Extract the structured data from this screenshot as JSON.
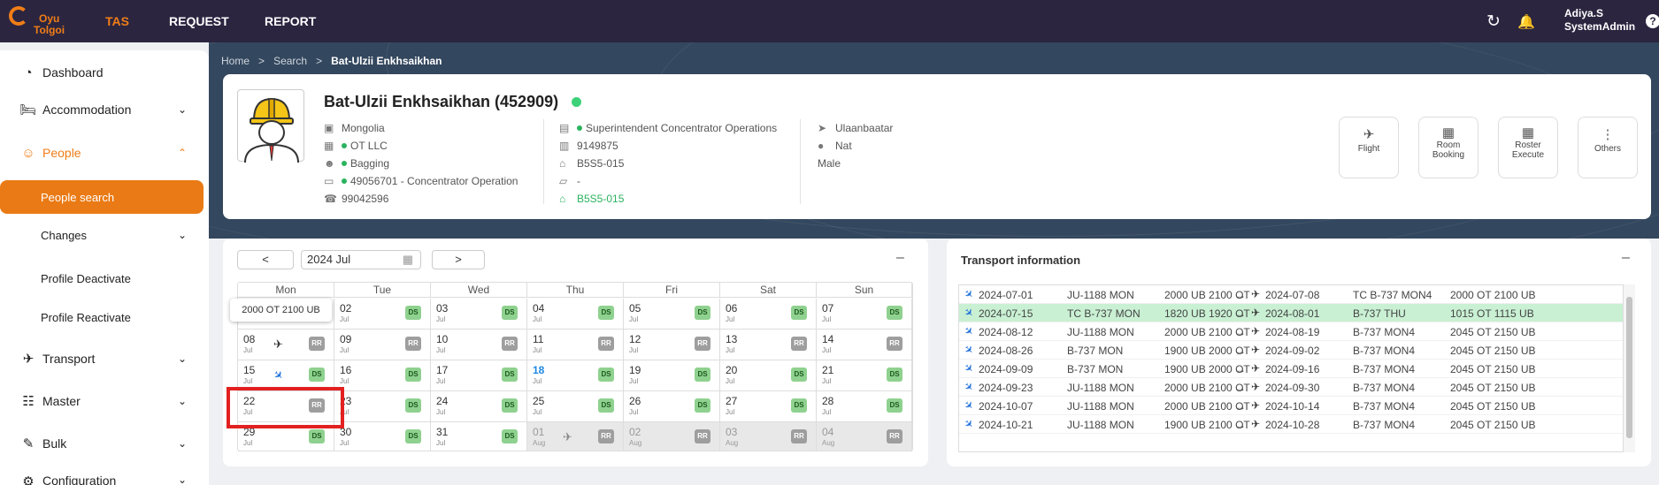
{
  "topbar": {
    "logo_line1": "Oyu",
    "logo_line2": "Tolgoi",
    "nav": [
      "TAS",
      "REQUEST",
      "REPORT"
    ],
    "user_name": "Adiya.S",
    "user_role": "SystemAdmin",
    "help": "?"
  },
  "sidebar": {
    "dashboard": "Dashboard",
    "accommodation": "Accommodation",
    "people": "People",
    "people_search": "People search",
    "changes": "Changes",
    "profile_deactivate": "Profile Deactivate",
    "profile_reactivate": "Profile Reactivate",
    "transport": "Transport",
    "master": "Master",
    "bulk": "Bulk",
    "configuration": "Configuration"
  },
  "breadcrumb": {
    "home": "Home",
    "sep": ">",
    "search": "Search",
    "current": "Bat-Ulzii Enkhsaikhan"
  },
  "profile": {
    "name": "Bat-Ulzii Enkhsaikhan (452909)",
    "col1": [
      "Mongolia",
      "OT LLC",
      "Bagging",
      "49056701 - Concentrator Operation",
      "99042596"
    ],
    "col2": [
      "Superintendent Concentrator Operations",
      "9149875",
      "B5S5-015",
      "-",
      "B5S5-015"
    ],
    "col3": [
      "Ulaanbaatar",
      "Nat",
      "Male"
    ],
    "actions": {
      "flight": "Flight",
      "room1": "Room",
      "room2": "Booking",
      "roster1": "Roster",
      "roster2": "Execute",
      "others": "Others"
    }
  },
  "calendar": {
    "prev": "<",
    "next": ">",
    "month": "2024 Jul",
    "minus": "–",
    "weekdays": [
      "Mon",
      "Tue",
      "Wed",
      "Thu",
      "Fri",
      "Sat",
      "Sun"
    ],
    "tooltip": "2000 OT 2100 UB",
    "month_label": "Jul",
    "aug_label": "Aug",
    "badges": {
      "ds": "DS",
      "rr": "RR"
    },
    "rows": [
      [
        "",
        "02",
        "03",
        "04",
        "05",
        "06",
        "07"
      ],
      [
        "08",
        "09",
        "10",
        "11",
        "12",
        "13",
        "14"
      ],
      [
        "15",
        "16",
        "17",
        "18",
        "19",
        "20",
        "21"
      ],
      [
        "22",
        "23",
        "24",
        "25",
        "26",
        "27",
        "28"
      ],
      [
        "29",
        "30",
        "31",
        "01",
        "02",
        "03",
        "04"
      ]
    ]
  },
  "transport": {
    "title": "Transport information",
    "minus": "–",
    "rows": [
      [
        "2024-07-01",
        "JU-1188 MON",
        "2000 UB 2100 OT",
        "→",
        "2024-07-08",
        "TC B-737 MON4",
        "2000 OT 2100 UB"
      ],
      [
        "2024-07-15",
        "TC B-737 MON",
        "1820 UB 1920 OT",
        "→",
        "2024-08-01",
        "B-737 THU",
        "1015 OT 1115 UB"
      ],
      [
        "2024-08-12",
        "JU-1188 MON",
        "2000 UB 2100 OT",
        "→",
        "2024-08-19",
        "B-737 MON4",
        "2045 OT 2150 UB"
      ],
      [
        "2024-08-26",
        "B-737 MON",
        "1900 UB 2000 OT",
        "→",
        "2024-09-02",
        "B-737 MON4",
        "2045 OT 2150 UB"
      ],
      [
        "2024-09-09",
        "B-737 MON",
        "1900 UB 2000 OT",
        "→",
        "2024-09-16",
        "B-737 MON4",
        "2045 OT 2150 UB"
      ],
      [
        "2024-09-23",
        "JU-1188 MON",
        "2000 UB 2100 OT",
        "→",
        "2024-09-30",
        "B-737 MON4",
        "2045 OT 2150 UB"
      ],
      [
        "2024-10-07",
        "JU-1188 MON",
        "2000 UB 2100 OT",
        "→",
        "2024-10-14",
        "B-737 MON4",
        "2045 OT 2150 UB"
      ],
      [
        "2024-10-21",
        "JU-1188 MON",
        "1900 UB 2100 OT",
        "→",
        "2024-10-28",
        "B-737 MON4",
        "2045 OT 2150 UB"
      ]
    ]
  },
  "colors": {
    "accent": "#f07d17",
    "topbar": "#2b2540",
    "banner": "#33475e",
    "ds_badge": "#8fd18f",
    "rr_badge": "#9e9e9e",
    "highlight_row": "#c9f0d3",
    "annotation_box": "#e32020"
  }
}
